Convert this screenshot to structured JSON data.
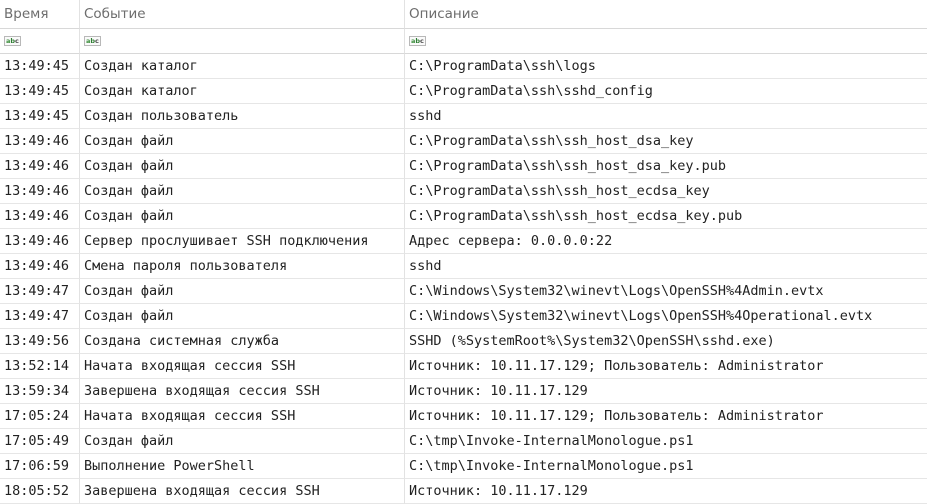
{
  "columns": {
    "time": "Время",
    "event": "Событие",
    "description": "Описание"
  },
  "filter_icon": "abc-text-filter-icon",
  "rows": [
    {
      "time": "13:49:45",
      "event": "Создан каталог",
      "description": "C:\\ProgramData\\ssh\\logs"
    },
    {
      "time": "13:49:45",
      "event": "Создан каталог",
      "description": "C:\\ProgramData\\ssh\\sshd_config"
    },
    {
      "time": "13:49:45",
      "event": "Создан пользователь",
      "description": "sshd"
    },
    {
      "time": "13:49:46",
      "event": "Создан файл",
      "description": "C:\\ProgramData\\ssh\\ssh_host_dsa_key"
    },
    {
      "time": "13:49:46",
      "event": "Создан файл",
      "description": "C:\\ProgramData\\ssh\\ssh_host_dsa_key.pub"
    },
    {
      "time": "13:49:46",
      "event": "Создан файл",
      "description": "C:\\ProgramData\\ssh\\ssh_host_ecdsa_key"
    },
    {
      "time": "13:49:46",
      "event": "Создан файл",
      "description": "C:\\ProgramData\\ssh\\ssh_host_ecdsa_key.pub"
    },
    {
      "time": "13:49:46",
      "event": "Сервер прослушивает SSH подключения",
      "description": "Адрес сервера: 0.0.0.0:22"
    },
    {
      "time": "13:49:46",
      "event": "Смена пароля пользователя",
      "description": "sshd"
    },
    {
      "time": "13:49:47",
      "event": "Создан файл",
      "description": "C:\\Windows\\System32\\winevt\\Logs\\OpenSSH%4Admin.evtx"
    },
    {
      "time": "13:49:47",
      "event": "Создан файл",
      "description": "C:\\Windows\\System32\\winevt\\Logs\\OpenSSH%4Operational.evtx"
    },
    {
      "time": "13:49:56",
      "event": "Создана системная служба",
      "description": "SSHD (%SystemRoot%\\System32\\OpenSSH\\sshd.exe)"
    },
    {
      "time": "13:52:14",
      "event": "Начата входящая сессия SSH",
      "description": "Источник: 10.11.17.129; Пользователь: Administrator"
    },
    {
      "time": "13:59:34",
      "event": "Завершена входящая сессия SSH",
      "description": "Источник: 10.11.17.129"
    },
    {
      "time": "17:05:24",
      "event": "Начата входящая сессия SSH",
      "description": "Источник: 10.11.17.129; Пользователь: Administrator"
    },
    {
      "time": "17:05:49",
      "event": "Создан файл",
      "description": "C:\\tmp\\Invoke-InternalMonologue.ps1"
    },
    {
      "time": "17:06:59",
      "event": "Выполнение PowerShell",
      "description": "C:\\tmp\\Invoke-InternalMonologue.ps1"
    },
    {
      "time": "18:05:52",
      "event": "Завершена входящая сессия SSH",
      "description": "Источник: 10.11.17.129"
    }
  ]
}
